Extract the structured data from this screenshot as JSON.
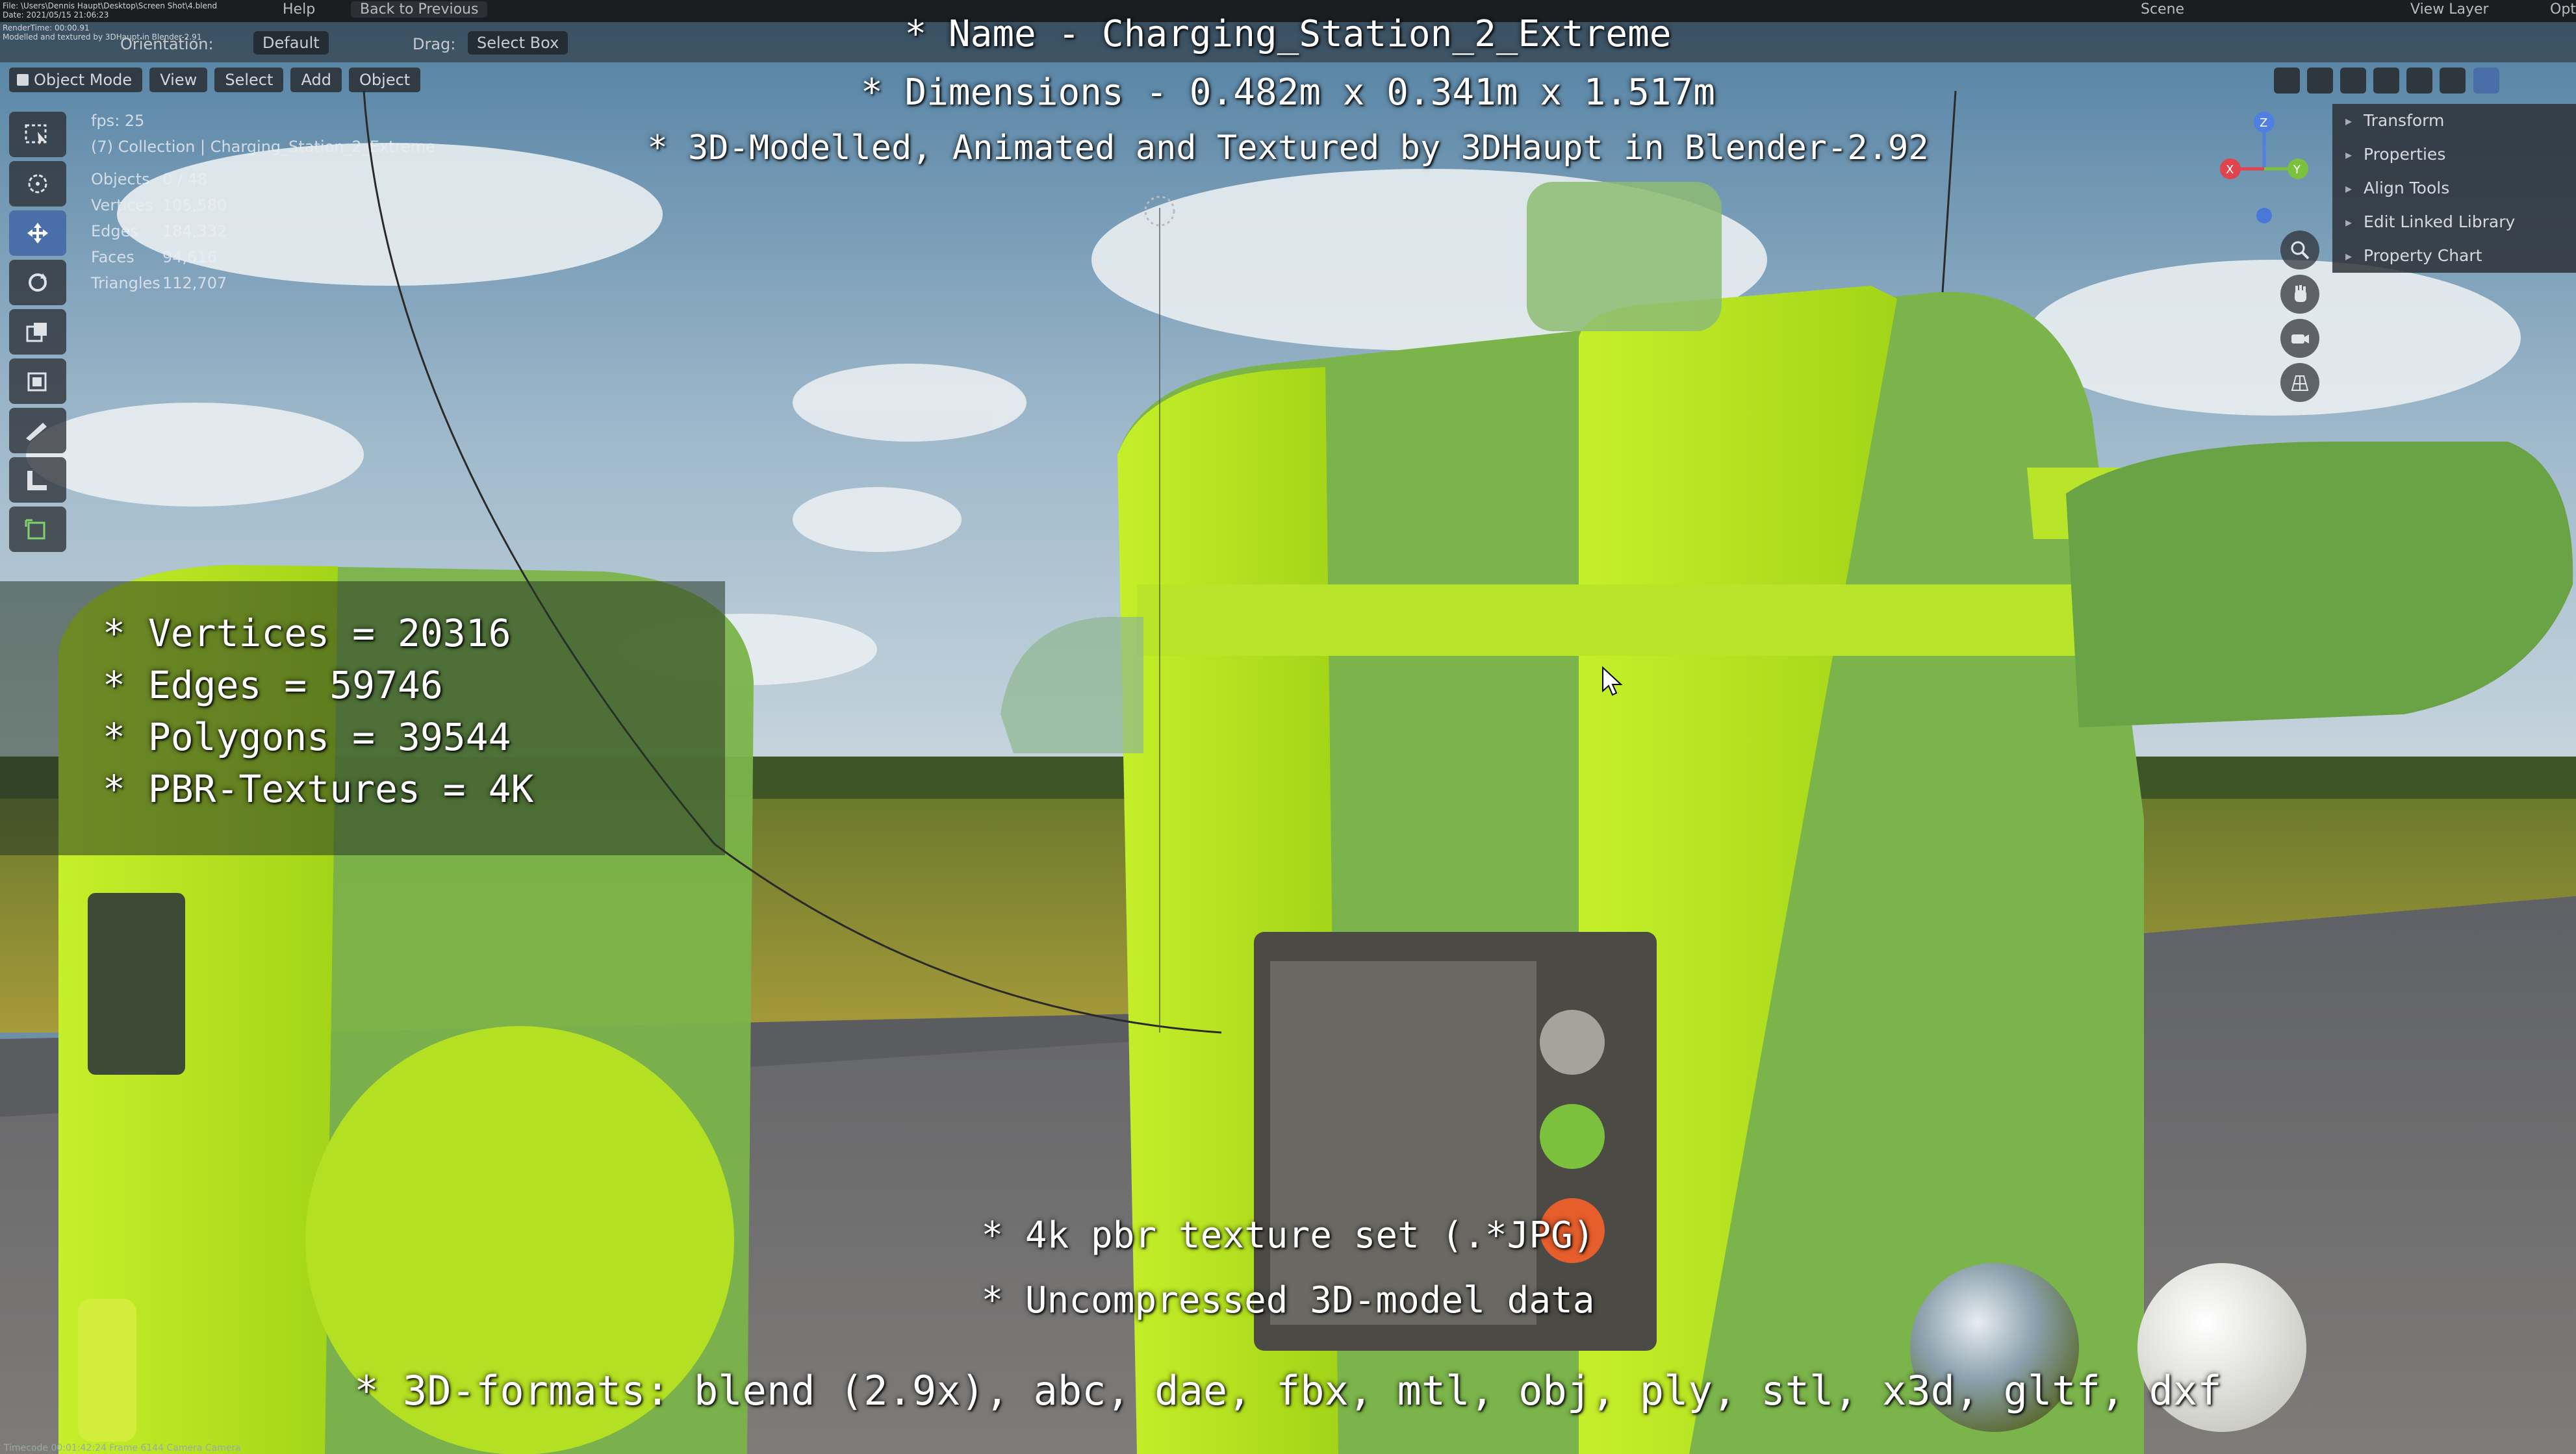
{
  "topbar": {
    "help": "Help",
    "back_to_previous": "Back to Previous",
    "scene": "Scene",
    "view_layer": "View Layer",
    "options": "Opti"
  },
  "file_info": {
    "line1": "File: \\Users\\Dennis Haupt\\Desktop\\Screen Shot\\4.blend",
    "line2": "Date: 2021/05/15 21:06:23",
    "line3": "RenderTime: 00:00.91",
    "line4": "Modelled and textured by 3DHaupt in Blender-2.91"
  },
  "header": {
    "orientation_label": "Orientation:",
    "orientation_value": "Default",
    "drag_label": "Drag:",
    "drag_value": "Select Box"
  },
  "menubar": {
    "mode": "Object Mode",
    "view": "View",
    "select": "Select",
    "add": "Add",
    "object": "Object"
  },
  "stats": {
    "fps": "fps: 25",
    "collection": "(7) Collection | Charging_Station_2_Extreme",
    "objects_label": "Objects",
    "objects_value": "0 / 48",
    "vertices_label": "Vertices",
    "vertices_value": "105,580",
    "edges_label": "Edges",
    "edges_value": "184,332",
    "faces_label": "Faces",
    "faces_value": "94,616",
    "triangles_label": "Triangles",
    "triangles_value": "112,707"
  },
  "overlay": {
    "name": "* Name - Charging_Station_2_Extreme",
    "dimensions": "* Dimensions -  0.482m x 0.341m x 1.517m",
    "credit": "* 3D-Modelled, Animated and Textured by 3DHaupt in Blender-2.92",
    "vertices": "* Vertices = 20316",
    "edges": "* Edges = 59746",
    "polygons": "* Polygons = 39544",
    "textures": "* PBR-Textures = 4K",
    "note_textures": "* 4k pbr texture set (.*JPG)",
    "note_data": "* Uncompressed 3D-model data",
    "formats": "* 3D-formats: blend (2.9x), abc, dae, fbx, mtl, obj, ply, stl, x3d, gltf, dxf"
  },
  "side_panel": {
    "items": [
      "Transform",
      "Properties",
      "Align Tools",
      "Edit Linked Library",
      "Property Chart"
    ]
  },
  "status_bar": {
    "text": "Timecode 00:01:42:24   Frame 6144   Camera Camera"
  },
  "colors": {
    "station_lime": "#b6e61c",
    "station_green": "#6fa84a",
    "toolbar_active": "#4a6fa8"
  }
}
